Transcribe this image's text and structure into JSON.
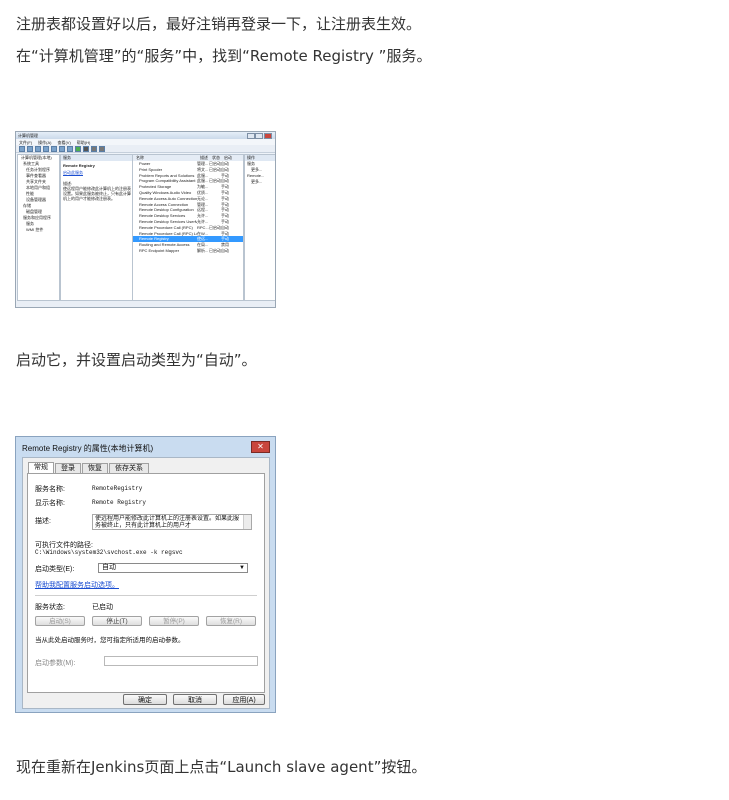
{
  "paragraphs": {
    "p1": "注册表都设置好以后，最好注销再登录一下，让注册表生效。",
    "p2": "在“计算机管理”的“服务”中，找到“Remote Registry ”服务。",
    "p3": "启动它，并设置启动类型为“自动”。",
    "p4": "现在重新在Jenkins页面上点击“Launch slave agent”按钮。"
  },
  "services_console": {
    "title": "计算机管理",
    "menu": [
      "文件(F)",
      "操作(A)",
      "查看(V)",
      "帮助(H)"
    ],
    "tree": [
      "计算机管理(本地)",
      "系统工具",
      "任务计划程序",
      "事件查看器",
      "共享文件夹",
      "本地用户和组",
      "性能",
      "设备管理器",
      "存储",
      "磁盘管理",
      "服务和应用程序",
      "服务",
      "WMI 控件"
    ],
    "desc_header": "服务",
    "selected_service": "Remote Registry",
    "start_link": "启动此服务",
    "desc_heading": "描述:",
    "desc_text": "使远程用户能修改此计算机上的注册表设置。如果此服务被终止，只有此计算机上的用户才能修改注册表。",
    "columns": [
      "名称",
      "描述",
      "状态",
      "启动"
    ],
    "rows": [
      {
        "name": "Power",
        "desc": "管理...",
        "status": "已启动",
        "start": "自动"
      },
      {
        "name": "Print Spooler",
        "desc": "将文...",
        "status": "已启动",
        "start": "自动"
      },
      {
        "name": "Problem Reports and Solutions",
        "desc": "此服...",
        "status": "",
        "start": "手动"
      },
      {
        "name": "Program Compatibility Assistant",
        "desc": "此服...",
        "status": "已启动",
        "start": "自动"
      },
      {
        "name": "Protected Storage",
        "desc": "为敏...",
        "status": "",
        "start": "手动"
      },
      {
        "name": "Quality Windows Audio Video",
        "desc": "优质...",
        "status": "",
        "start": "手动"
      },
      {
        "name": "Remote Access Auto Connection",
        "desc": "无论...",
        "status": "",
        "start": "手动"
      },
      {
        "name": "Remote Access Connection",
        "desc": "管理...",
        "status": "",
        "start": "手动"
      },
      {
        "name": "Remote Desktop Configuration",
        "desc": "远程...",
        "status": "",
        "start": "手动"
      },
      {
        "name": "Remote Desktop Services",
        "desc": "允许...",
        "status": "",
        "start": "手动"
      },
      {
        "name": "Remote Desktop Services UserMode",
        "desc": "允许...",
        "status": "",
        "start": "手动"
      },
      {
        "name": "Remote Procedure Call (RPC)",
        "desc": "RPC...",
        "status": "已启动",
        "start": "自动"
      },
      {
        "name": "Remote Procedure Call (RPC) Locator",
        "desc": "在W...",
        "status": "",
        "start": "手动"
      },
      {
        "name": "Remote Registry",
        "desc": "使远...",
        "status": "",
        "start": "手动"
      },
      {
        "name": "Routing and Remote Access",
        "desc": "在局...",
        "status": "",
        "start": "禁用"
      },
      {
        "name": "RPC Endpoint Mapper",
        "desc": "解析...",
        "status": "已启动",
        "start": "自动"
      }
    ],
    "actions": {
      "header": "操作",
      "group1": "服务",
      "more1": "更多...",
      "group2": "Remote...",
      "more2": "更多..."
    }
  },
  "dialog": {
    "title": "Remote Registry 的属性(本地计算机)",
    "close_glyph": "✕",
    "tabs": [
      "常规",
      "登录",
      "恢复",
      "依存关系"
    ],
    "service_name_label": "服务名称:",
    "service_name": "RemoteRegistry",
    "display_name_label": "显示名称:",
    "display_name": "Remote Registry",
    "description_label": "描述:",
    "description": "使远程用户能修改此计算机上的注册表设置。如果此服务被终止，只有此计算机上的用户才",
    "path_label": "可执行文件的路径:",
    "path": "C:\\Windows\\system32\\svchost.exe -k regsvc",
    "startup_label": "启动类型(E):",
    "startup_value": "自动",
    "help_link": "帮助我配置服务启动选项。",
    "status_label": "服务状态:",
    "status_value": "已启动",
    "btn_start": "启动(S)",
    "btn_stop": "停止(T)",
    "btn_pause": "暂停(P)",
    "btn_resume": "恢复(R)",
    "hint": "当从此处启动服务时，您可指定所适用的启动参数。",
    "params_label": "启动参数(M):",
    "ok": "确定",
    "cancel": "取消",
    "apply": "应用(A)"
  }
}
